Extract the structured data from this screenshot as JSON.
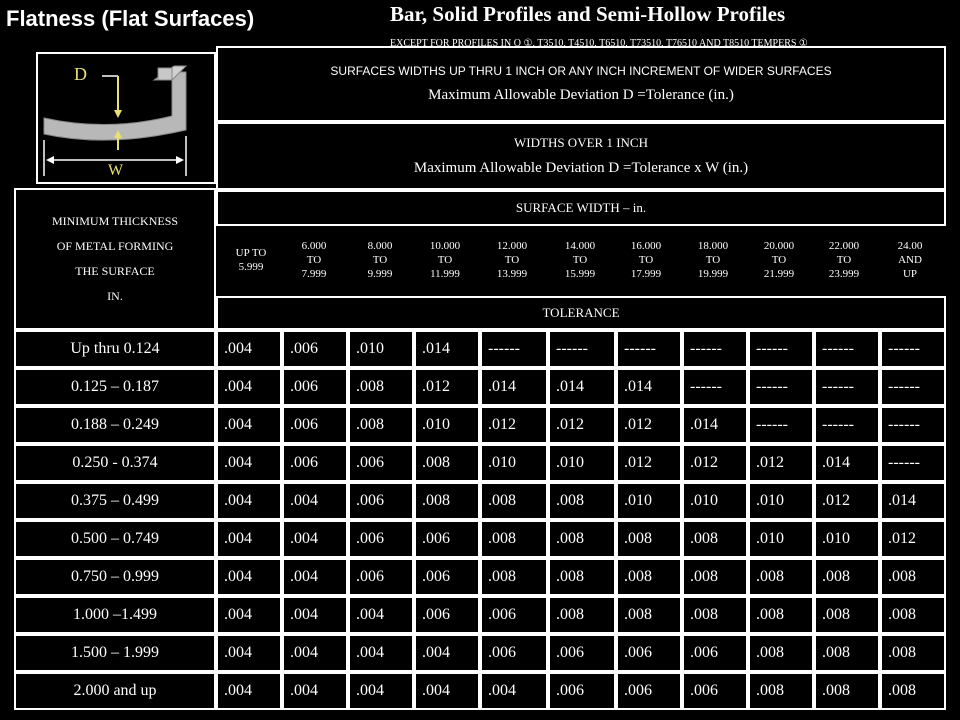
{
  "header": {
    "left_title": "Flatness (Flat Surfaces)",
    "right_title": "Bar, Solid Profiles and Semi-Hollow Profiles",
    "subtitle": "EXCEPT FOR PROFILES IN O ①, T3510, T4510, T6510, T73510, T76510 AND T8510 TEMPERS ①"
  },
  "diagram": {
    "label_d": "D",
    "label_w": "W"
  },
  "boxes": {
    "surfaces_caption": "SURFACES WIDTHS UP THRU 1 INCH OR ANY INCH INCREMENT OF WIDER SURFACES",
    "surfaces_deviation": "Maximum Allowable Deviation D =Tolerance (in.)",
    "wide_caption": "WIDTHS OVER 1 INCH",
    "wide_deviation": "Maximum Allowable Deviation D =Tolerance x W (in.)",
    "surface_width": "SURFACE WIDTH – in.",
    "min_thickness": "MINIMUM THICKNESS\nOF METAL FORMING\nTHE SURFACE\nIN.",
    "tolerance": "TOLERANCE"
  },
  "width_columns": [
    "UP TO\n5.999",
    "6.000\nTO\n7.999",
    "8.000\nTO\n9.999",
    "10.000\nTO\n11.999",
    "12.000\nTO\n13.999",
    "14.000\nTO\n15.999",
    "16.000\nTO\n17.999",
    "18.000\nTO\n19.999",
    "20.000\nTO\n21.999",
    "22.000\nTO\n23.999",
    "24.00\nAND\nUP"
  ],
  "rows": [
    {
      "thickness": "Up thru 0.124",
      "values": [
        ".004",
        ".006",
        ".010",
        ".014",
        "------",
        "------",
        "------",
        "------",
        "------",
        "------",
        "------"
      ]
    },
    {
      "thickness": "0.125 – 0.187",
      "values": [
        ".004",
        ".006",
        ".008",
        ".012",
        ".014",
        ".014",
        ".014",
        "------",
        "------",
        "------",
        "------"
      ]
    },
    {
      "thickness": "0.188 – 0.249",
      "values": [
        ".004",
        ".006",
        ".008",
        ".010",
        ".012",
        ".012",
        ".012",
        ".014",
        "------",
        "------",
        "------"
      ]
    },
    {
      "thickness": "0.250 - 0.374",
      "values": [
        ".004",
        ".006",
        ".006",
        ".008",
        ".010",
        ".010",
        ".012",
        ".012",
        ".012",
        ".014",
        "------"
      ]
    },
    {
      "thickness": "0.375 – 0.499",
      "values": [
        ".004",
        ".004",
        ".006",
        ".008",
        ".008",
        ".008",
        ".010",
        ".010",
        ".010",
        ".012",
        ".014"
      ]
    },
    {
      "thickness": "0.500 – 0.749",
      "values": [
        ".004",
        ".004",
        ".006",
        ".006",
        ".008",
        ".008",
        ".008",
        ".008",
        ".010",
        ".010",
        ".012"
      ]
    },
    {
      "thickness": "0.750 – 0.999",
      "values": [
        ".004",
        ".004",
        ".006",
        ".006",
        ".008",
        ".008",
        ".008",
        ".008",
        ".008",
        ".008",
        ".008"
      ]
    },
    {
      "thickness": "1.000 –1.499",
      "values": [
        ".004",
        ".004",
        ".004",
        ".006",
        ".006",
        ".008",
        ".008",
        ".008",
        ".008",
        ".008",
        ".008"
      ]
    },
    {
      "thickness": "1.500 – 1.999",
      "values": [
        ".004",
        ".004",
        ".004",
        ".004",
        ".006",
        ".006",
        ".006",
        ".006",
        ".008",
        ".008",
        ".008"
      ]
    },
    {
      "thickness": "2.000 and up",
      "values": [
        ".004",
        ".004",
        ".004",
        ".004",
        ".004",
        ".006",
        ".006",
        ".006",
        ".008",
        ".008",
        ".008"
      ]
    }
  ],
  "colors": {
    "background": "#000000",
    "border": "#ffffff",
    "text": "#ffffff",
    "diagram_metal": "#b8b8b8",
    "diagram_arrow": "#e8e070"
  }
}
